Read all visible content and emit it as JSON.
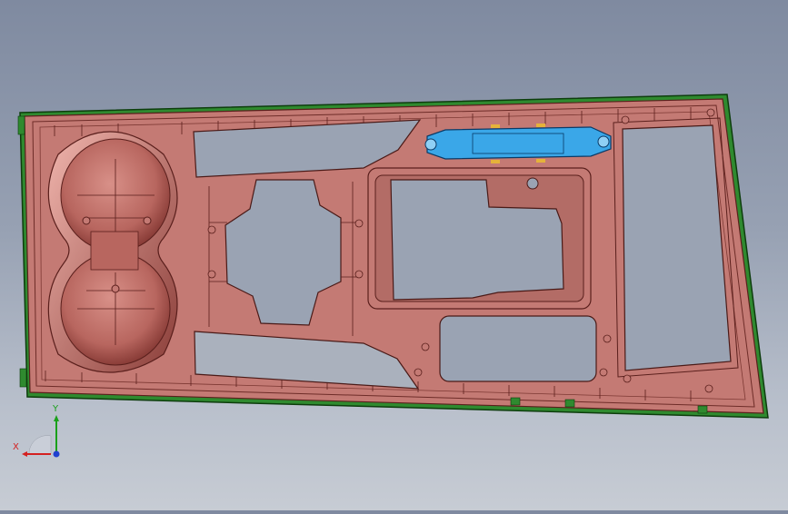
{
  "viewport": {
    "background_top": "#7f8aa0",
    "background_bottom": "#c7ccd4",
    "part_color": "#c47a74",
    "part_edge": "#5a1f1c",
    "flange_color": "#2f8a2f",
    "highlight_color": "#3aa7e8"
  },
  "triad": {
    "x_label": "X",
    "y_label": "Y",
    "x_color": "#d42020",
    "y_color": "#1aa01a",
    "z_color": "#2040d0"
  }
}
